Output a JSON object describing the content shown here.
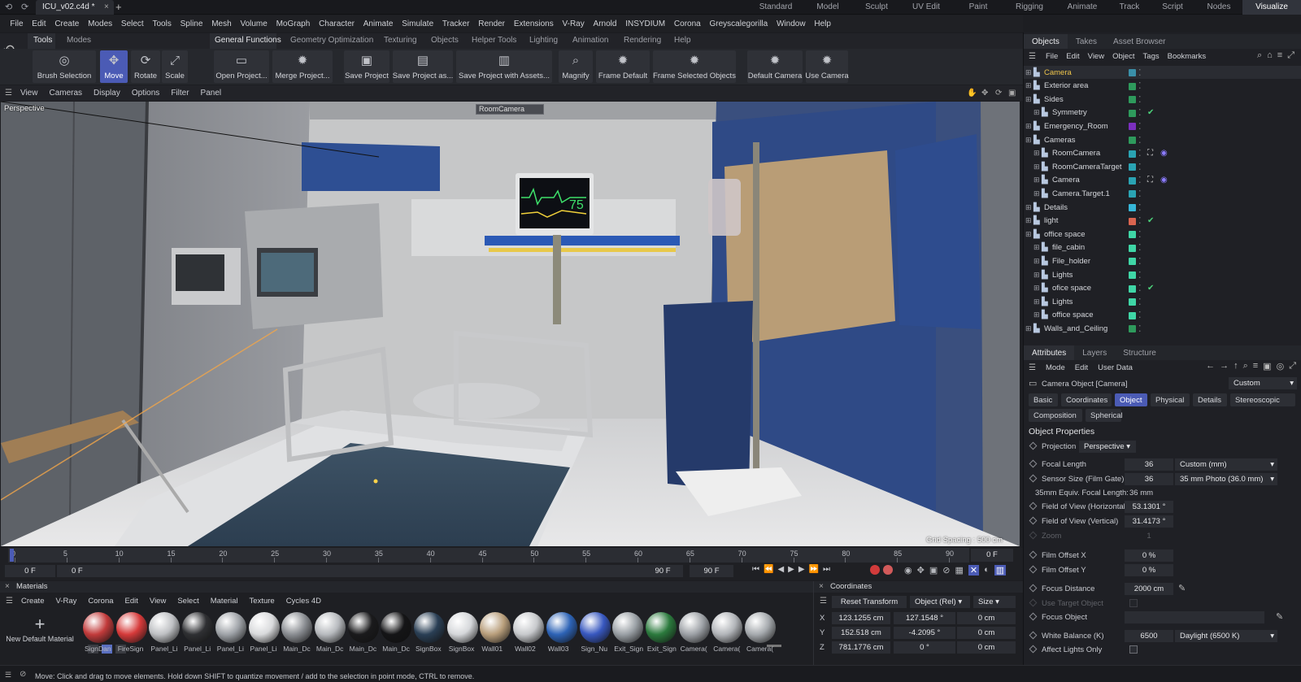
{
  "app": {
    "file_tab": "ICU_v02.c4d *"
  },
  "layouts": {
    "items": [
      "Standard",
      "Model",
      "Sculpt",
      "UV Edit",
      "Paint",
      "Rigging",
      "Animate",
      "Track",
      "Script",
      "Nodes",
      "Visualize"
    ],
    "active": "Visualize"
  },
  "menubar": {
    "items": [
      "File",
      "Edit",
      "Create",
      "Modes",
      "Select",
      "Tools",
      "Spline",
      "Mesh",
      "Volume",
      "MoGraph",
      "Character",
      "Animate",
      "Simulate",
      "Tracker",
      "Render",
      "Extensions",
      "V-Ray",
      "Arnold",
      "INSYDIUM",
      "Corona",
      "Greyscalegorilla",
      "Window",
      "Help"
    ]
  },
  "toolbar_tabs": {
    "left": [
      "Tools",
      "Modes"
    ],
    "right": [
      "General Functions",
      "Geometry Optimization",
      "Texturing",
      "Objects",
      "Helper Tools",
      "Lighting",
      "Animation",
      "Rendering",
      "Help"
    ]
  },
  "toolbar": {
    "tools": [
      "Brush Selection",
      "Move",
      "Rotate",
      "Scale"
    ],
    "functions": [
      "Open Project...",
      "Merge Project...",
      "Save Project",
      "Save Project as...",
      "Save Project with Assets...",
      "Magnify",
      "Frame Default",
      "Frame Selected Objects",
      "Default Camera",
      "Use Camera"
    ]
  },
  "viewport": {
    "menu": [
      "View",
      "Cameras",
      "Display",
      "Options",
      "Filter",
      "Panel"
    ],
    "label": "Perspective",
    "camera_tag": "RoomCamera",
    "grid_spacing": "Grid Spacing : 500 cm",
    "monitor_value": "75"
  },
  "timeline": {
    "ticks": [
      "0",
      "5",
      "10",
      "15",
      "20",
      "25",
      "30",
      "35",
      "40",
      "45",
      "50",
      "55",
      "60",
      "65",
      "70",
      "75",
      "80",
      "85",
      "90"
    ],
    "end_frame_box": "0 F",
    "start": "0 F",
    "current": "0 F",
    "end": "90 F",
    "end2": "90 F"
  },
  "materials": {
    "header": "Materials",
    "menu": [
      "Create",
      "V-Ray",
      "Corona",
      "Edit",
      "View",
      "Select",
      "Material",
      "Texture",
      "Cycles 4D"
    ],
    "new_label": "New Default Material",
    "items": [
      {
        "name": "SignDan",
        "color": "#c23b3b"
      },
      {
        "name": "FireSign",
        "color": "#d63a3a"
      },
      {
        "name": "Panel_Li",
        "color": "#bfc1c4"
      },
      {
        "name": "Panel_Li",
        "color": "#2f3033"
      },
      {
        "name": "Panel_Li",
        "color": "#9fa3a8"
      },
      {
        "name": "Panel_Li",
        "color": "#d9dadc"
      },
      {
        "name": "Main_Dc",
        "color": "#8a8d92"
      },
      {
        "name": "Main_Dc",
        "color": "#b7babe"
      },
      {
        "name": "Main_Dc",
        "color": "#1a1a1c"
      },
      {
        "name": "Main_Dc",
        "color": "#141416"
      },
      {
        "name": "SignBox",
        "color": "#2a3f55"
      },
      {
        "name": "SignBox",
        "color": "#d5d7da"
      },
      {
        "name": "Wall01",
        "color": "#b99f7c"
      },
      {
        "name": "Wall02",
        "color": "#c7c9cc"
      },
      {
        "name": "Wall03",
        "color": "#2d63b6"
      },
      {
        "name": "Sign_Nu",
        "color": "#3858c0"
      },
      {
        "name": "Exit_Sign",
        "color": "#9aa0a5"
      },
      {
        "name": "Exit_Sign",
        "color": "#2b7a3d"
      },
      {
        "name": "Camera(",
        "color": "#9da1a6"
      },
      {
        "name": "Camera(",
        "color": "#b2b5b9"
      },
      {
        "name": "Camera(",
        "color": "#a6aaae"
      }
    ]
  },
  "coordinates": {
    "header": "Coordinates",
    "reset": "Reset Transform",
    "mode": "Object (Rel)",
    "size": "Size",
    "rows": [
      {
        "axis": "X",
        "pos": "123.1255 cm",
        "rot": "127.1548 °",
        "size": "0 cm"
      },
      {
        "axis": "Y",
        "pos": "152.518 cm",
        "rot": "-4.2095 °",
        "size": "0 cm"
      },
      {
        "axis": "Z",
        "pos": "781.1776 cm",
        "rot": "0 °",
        "size": "0 cm"
      }
    ]
  },
  "objects_panel": {
    "tabs": [
      "Objects",
      "Takes",
      "Asset Browser"
    ],
    "menu": [
      "File",
      "Edit",
      "View",
      "Object",
      "Tags",
      "Bookmarks"
    ],
    "items": [
      {
        "name": "Camera",
        "indent": 0,
        "color": "#3a8fa8",
        "highlight": true
      },
      {
        "name": "Exterior area",
        "indent": 0,
        "color": "#2e9a5c"
      },
      {
        "name": "Sides",
        "indent": 0,
        "color": "#2e9a5c"
      },
      {
        "name": "Symmetry",
        "indent": 1,
        "color": "#2e9a5c",
        "check": true
      },
      {
        "name": "Emergency_Room",
        "indent": 0,
        "color": "#7b2fbf"
      },
      {
        "name": "Cameras",
        "indent": 0,
        "color": "#2e9a5c"
      },
      {
        "name": "RoomCamera",
        "indent": 1,
        "color": "#2aa3b3",
        "target": true
      },
      {
        "name": "RoomCameraTarget",
        "indent": 1,
        "color": "#2aa3b3"
      },
      {
        "name": "Camera",
        "indent": 1,
        "color": "#2aa3b3",
        "target": true
      },
      {
        "name": "Camera.Target.1",
        "indent": 1,
        "color": "#2aa3b3"
      },
      {
        "name": "Details",
        "indent": 0,
        "color": "#36b6d8"
      },
      {
        "name": "light",
        "indent": 0,
        "color": "#d9644f",
        "check": true
      },
      {
        "name": "office space",
        "indent": 0,
        "color": "#3fd6a6"
      },
      {
        "name": "file_cabin",
        "indent": 1,
        "color": "#3fd6a6"
      },
      {
        "name": "File_holder",
        "indent": 1,
        "color": "#3fd6a6"
      },
      {
        "name": "Lights",
        "indent": 1,
        "color": "#3fd6a6"
      },
      {
        "name": "ofice space",
        "indent": 1,
        "color": "#3fd6a6",
        "check": true
      },
      {
        "name": "Lights",
        "indent": 1,
        "color": "#3fd6a6"
      },
      {
        "name": "office space",
        "indent": 1,
        "color": "#3fd6a6"
      },
      {
        "name": "Walls_and_Ceiling",
        "indent": 0,
        "color": "#2e9a5c"
      }
    ]
  },
  "attributes": {
    "tabs": [
      "Attributes",
      "Layers",
      "Structure"
    ],
    "menu": [
      "Mode",
      "Edit",
      "User Data"
    ],
    "object_title": "Camera Object [Camera]",
    "preset": "Custom",
    "subtabs": [
      "Basic",
      "Coordinates",
      "Object",
      "Physical",
      "Details",
      "Stereoscopic",
      "Composition",
      "Spherical"
    ],
    "active_subtab": "Object",
    "section": "Object Properties",
    "projection_label": "Projection",
    "projection_value": "Perspective",
    "props": [
      {
        "label": "Focal Length",
        "value": "36",
        "dropdown": "Custom (mm)"
      },
      {
        "label": "Sensor Size (Film Gate)",
        "value": "36",
        "dropdown": "35 mm Photo (36.0 mm)"
      },
      {
        "label": "35mm Equiv. Focal Length:",
        "value": "36 mm",
        "plain": true
      },
      {
        "label": "Field of View (Horizontal)",
        "value": "53.1301 °"
      },
      {
        "label": "Field of View (Vertical)",
        "value": "31.4173 °"
      },
      {
        "label": "Zoom",
        "value": "1",
        "disabled": true
      },
      {
        "label": "Film Offset X",
        "value": "0 %"
      },
      {
        "label": "Film Offset Y",
        "value": "0 %"
      },
      {
        "label": "Focus Distance",
        "value": "2000 cm"
      },
      {
        "label": "Use Target Object",
        "value": "",
        "disabled": true
      },
      {
        "label": "Focus Object",
        "value": ""
      },
      {
        "label": "White Balance (K)",
        "value": "6500",
        "dropdown": "Daylight (6500 K)"
      },
      {
        "label": "Affect Lights Only",
        "value": ""
      }
    ]
  },
  "status": {
    "text": "Move: Click and drag to move elements. Hold down SHIFT to quantize movement / add to the selection in point mode, CTRL to remove."
  }
}
